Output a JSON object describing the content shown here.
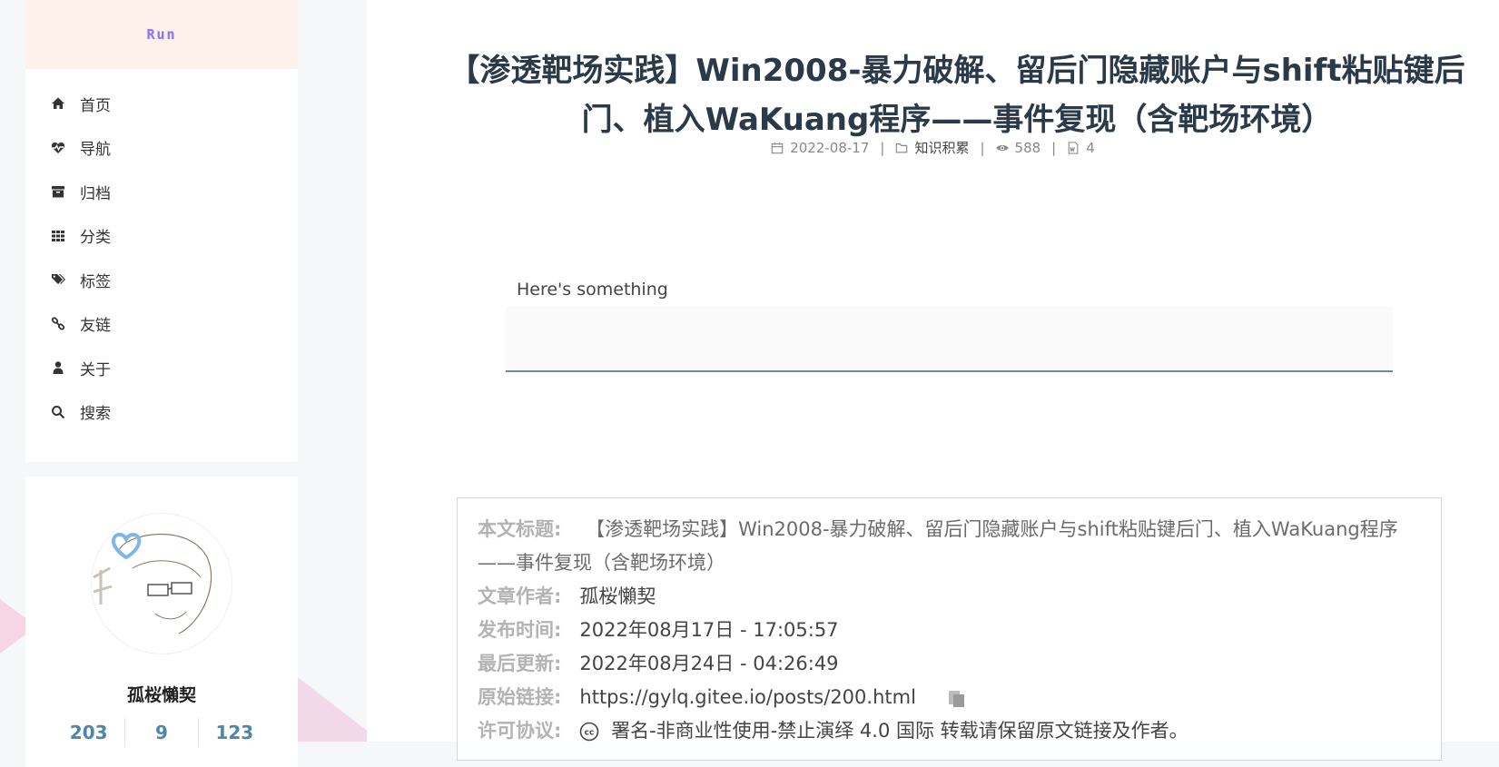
{
  "sidebar": {
    "brand_title": "Run",
    "menu": [
      {
        "label": "首页",
        "icon": "home-icon"
      },
      {
        "label": "导航",
        "icon": "heartbeat-icon"
      },
      {
        "label": "归档",
        "icon": "archive-icon"
      },
      {
        "label": "分类",
        "icon": "grid-icon"
      },
      {
        "label": "标签",
        "icon": "tags-icon"
      },
      {
        "label": "友链",
        "icon": "link-icon"
      },
      {
        "label": "关于",
        "icon": "user-icon"
      },
      {
        "label": "搜索",
        "icon": "search-icon"
      }
    ],
    "profile": {
      "name": "孤桜懶契",
      "stats": [
        "203",
        "9",
        "123"
      ]
    }
  },
  "post": {
    "title": "【渗透靶场实践】Win2008-暴力破解、留后门隐藏账户与shift粘贴键后门、植入WaKuang程序——事件复现（含靶场环境）",
    "meta": {
      "date": "2022-08-17",
      "category": "知识积累",
      "views": "588",
      "words": "4"
    },
    "password_prompt": "Here's something",
    "copyright": {
      "title_key": "本文标题:",
      "title_val": "【渗透靶场实践】Win2008-暴力破解、留后门隐藏账户与shift粘贴键后门、植入WaKuang程序——事件复现（含靶场环境）",
      "author_key": "文章作者:",
      "author_val": "孤桜懶契",
      "published_key": "发布时间:",
      "published_val": "2022年08月17日 - 17:05:57",
      "updated_key": "最后更新:",
      "updated_val": "2022年08月24日 - 04:26:49",
      "link_key": "原始链接:",
      "link_val": "https://gylq.gitee.io/posts/200.html",
      "license_key": "许可协议:",
      "license_val": "署名-非商业性使用-禁止演绎 4.0 国际 转载请保留原文链接及作者。"
    }
  },
  "colors": {
    "title": "#2b3a49",
    "accent": "#4e86a6",
    "brand_bg": "#fdf1ec",
    "brand_text": "#8a78f0"
  }
}
